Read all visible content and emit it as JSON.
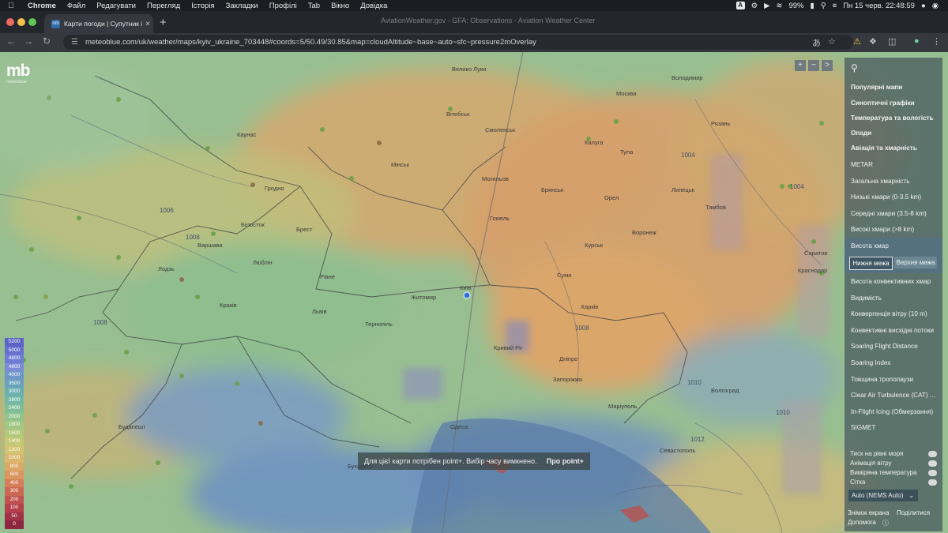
{
  "menubar": {
    "app_name": "Chrome",
    "items": [
      "Файл",
      "Редагувати",
      "Перегляд",
      "Історія",
      "Закладки",
      "Профілі",
      "Tab",
      "Вікно",
      "Довідка"
    ],
    "input_badge": "A",
    "battery": "99%",
    "datetime": "Пн 15 черв. 22:48:59"
  },
  "tabs": {
    "active_title": "Карти погоди | Супутник і м",
    "active_favicon": "mb",
    "ghost_title": "AviationWeather.gov - GFA: Observations - Aviation Weather Center"
  },
  "toolbar": {
    "url": "meteoblue.com/uk/weather/maps/kyiv_ukraine_703448#coords=5/50.49/30.85&map=cloudAltitude~base~auto~sfc~pressure2mOverlay"
  },
  "map": {
    "logo_text": "mb",
    "logo_sub": "meteoblue",
    "zoom_controls": [
      "+",
      "−",
      ">"
    ],
    "legend": [
      {
        "label": "5200",
        "color": "#5e63c8"
      },
      {
        "label": "5000",
        "color": "#6670cf"
      },
      {
        "label": "4800",
        "color": "#6e7cd3"
      },
      {
        "label": "4600",
        "color": "#7b8bd6"
      },
      {
        "label": "4000",
        "color": "#6f97c8"
      },
      {
        "label": "3500",
        "color": "#6aa2bd"
      },
      {
        "label": "3000",
        "color": "#6cafb1"
      },
      {
        "label": "2800",
        "color": "#73b8a4"
      },
      {
        "label": "2400",
        "color": "#80be98"
      },
      {
        "label": "2000",
        "color": "#8fc48c"
      },
      {
        "label": "1800",
        "color": "#a0c783"
      },
      {
        "label": "1600",
        "color": "#b3c97b"
      },
      {
        "label": "1400",
        "color": "#c3c976"
      },
      {
        "label": "1200",
        "color": "#d1c372"
      },
      {
        "label": "1000",
        "color": "#d9b86d"
      },
      {
        "label": "800",
        "color": "#dca866"
      },
      {
        "label": "600",
        "color": "#db955f"
      },
      {
        "label": "400",
        "color": "#d57e58"
      },
      {
        "label": "300",
        "color": "#cb6753"
      },
      {
        "label": "200",
        "color": "#c1524f"
      },
      {
        "label": "100",
        "color": "#b3404b"
      },
      {
        "label": "50",
        "color": "#a13246"
      },
      {
        "label": "0",
        "color": "#8d2641"
      }
    ],
    "cities": {
      "velyki_luky": "Велико Луки",
      "vitebsk": "Вітебськ",
      "smolensk": "Смоленськ",
      "vladimir": "Володимир",
      "moscow": "Москва",
      "kaluga": "Калуга",
      "tula": "Тула",
      "ryazan": "Рязань",
      "minsk": "Мінськ",
      "mahiliou": "Могильов",
      "bryansk": "Брянськ",
      "oryol": "Орел",
      "lipetsk": "Липецьк",
      "tambov": "Тамбов",
      "homel": "Гомель",
      "kursk": "Курськ",
      "voronezh": "Воронеж",
      "saratov": "Саратов",
      "kaunas": "Каунас",
      "hrodna": "Гродно",
      "bialystok": "Білосток",
      "warsaw": "Варшава",
      "brest": "Брест",
      "lodz": "Лодзь",
      "lublin": "Люблін",
      "rivne": "Рівне",
      "zhytomyr": "Житомир",
      "kyiv": "Київ",
      "sumy": "Суми",
      "kharkiv": "Харків",
      "krakow": "Краків",
      "lviv": "Львів",
      "ternopil": "Тернопіль",
      "dnipro": "Дніпро",
      "zaporizhzhia": "Запоріжжя",
      "mariupol": "Маріуполь",
      "volgograd": "Волгоград",
      "odesa": "Одеса",
      "kryvyi_rih": "Кривий Ріг",
      "sevastopol": "Севастополь",
      "krasnodar": "Краснодар",
      "budapest": "Будапешт",
      "bucharest": "Бухарест"
    },
    "isobars": [
      "1006",
      "1008",
      "1008",
      "1004",
      "1004",
      "1010",
      "1008",
      "1012",
      "1010"
    ],
    "notice": {
      "message": "Для цієї карти потрібен point+. Вибір часу вимкнено.",
      "link": "Про point+"
    }
  },
  "panel": {
    "headers": [
      "Популярні мапи",
      "Синоптичні графіки",
      "Температура та вологість",
      "Опади",
      "Авіація та хмарність"
    ],
    "items": [
      "METAR",
      "Загальна хмарність",
      "Низькі хмари (0-3.5 km)",
      "Середні хмари (3.5-8 km)",
      "Високі хмари (>8 km)"
    ],
    "selected": "Висота хмар",
    "lower_bound": "Нижня межа",
    "upper_bound": "Верхня межа",
    "items2": [
      "Висота конвективних хмар",
      "Видимість",
      "Конвергенція вітру (10 m)",
      "Конвективні висхідні потоки",
      "Soaring Flight Distance",
      "Soaring Index",
      "Товщина тропопаузи",
      "Clear Air Turbulence (CAT) ...",
      "In-Flight Icing (Обмерзання)",
      "SIGMET"
    ],
    "overlays": [
      "Тиск на рівні моря",
      "Анімація вітру",
      "Виміряна температура",
      "Сітка"
    ],
    "model": "Auto (NEMS Auto)",
    "screenshot": "Знімок екрана",
    "share": "Поділитися",
    "help": "Допомога"
  }
}
